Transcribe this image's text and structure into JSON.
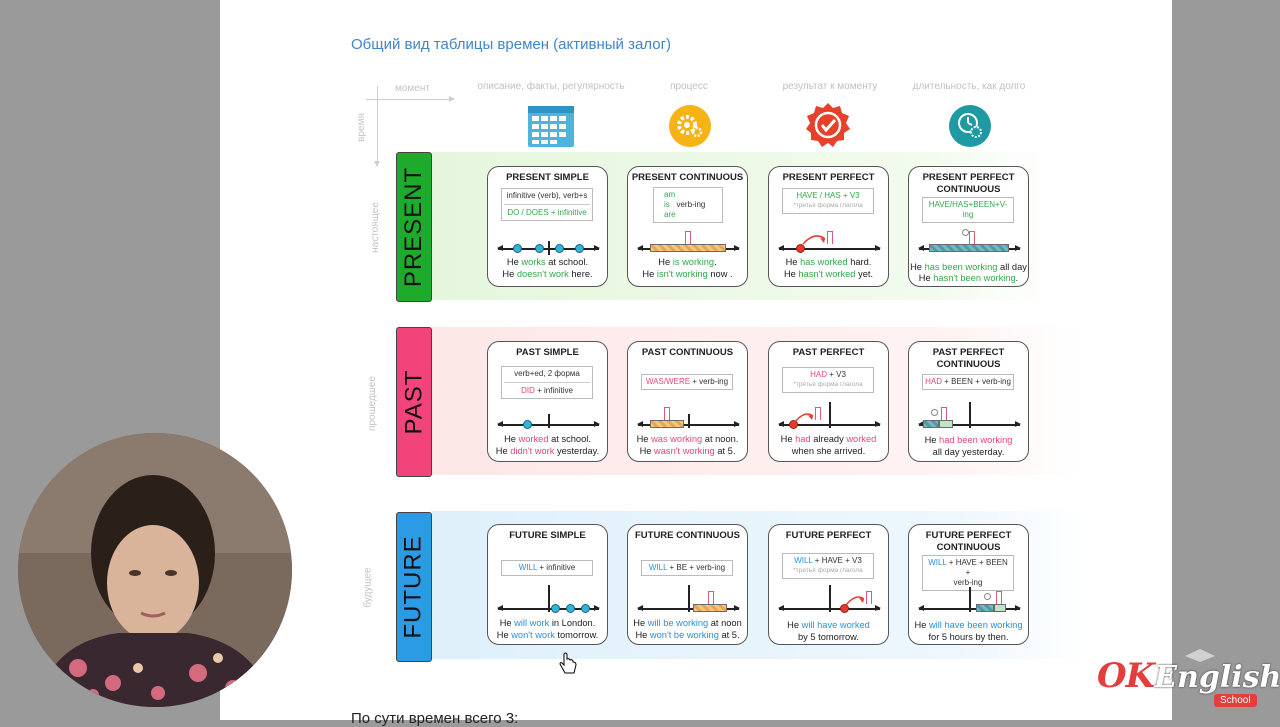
{
  "doc_title": "Общий вид таблицы времен (активный залог)",
  "next_heading": "По сути времен всего 3:",
  "axes": {
    "moment": "момент",
    "time": "время"
  },
  "column_headers": [
    "описание, факты, регулярность",
    "процесс",
    "результат к моменту",
    "длительность, как долго"
  ],
  "column_icons": [
    "calendar-icon",
    "gear-icon",
    "checkmark-badge-icon",
    "clock-gear-icon"
  ],
  "colors": {
    "present": "#1eaa2a",
    "past": "#f0447b",
    "future": "#2a9be4",
    "present_band": "#eef8e8",
    "past_band": "#fdeeee",
    "future_band": "#e8f3fb"
  },
  "rows": [
    {
      "tab": "PRESENT",
      "side": "настоящее",
      "cards": [
        {
          "title": "PRESENT SIMPLE",
          "formula": [
            "infinitive (verb), verb+s",
            "DO / DOES + infinitive"
          ],
          "ex1": [
            "He ",
            "works",
            " at school."
          ],
          "ex2": [
            "He ",
            "doesn't work",
            " here."
          ]
        },
        {
          "title": "PRESENT CONTINUOUS",
          "formula": [
            "am",
            "is   verb-ing",
            "are"
          ],
          "ex1": [
            "He ",
            "is working",
            "."
          ],
          "ex2": [
            "He ",
            "isn't working",
            " now ."
          ]
        },
        {
          "title": "PRESENT PERFECT",
          "formula": [
            "HAVE / HAS + V3",
            "*третья форма глагола"
          ],
          "ex1": [
            "He ",
            "has worked",
            " hard."
          ],
          "ex2": [
            "He ",
            "hasn't worked",
            " yet."
          ]
        },
        {
          "title": "PRESENT PERFECT CONTINUOUS",
          "formula": [
            "HAVE/HAS+BEEN+V-ing"
          ],
          "ex1": [
            "He ",
            "has been working",
            " all day"
          ],
          "ex2": [
            "He ",
            "hasn't been working",
            "."
          ]
        }
      ]
    },
    {
      "tab": "PAST",
      "side": "прошедшее",
      "cards": [
        {
          "title": "PAST SIMPLE",
          "formula": [
            "verb+ed, 2 форма",
            "DID + infinitive"
          ],
          "ex1": [
            "He ",
            "worked",
            " at school."
          ],
          "ex2": [
            "He ",
            "didn't work",
            " yesterday."
          ]
        },
        {
          "title": "PAST CONTINUOUS",
          "formula": [
            "WAS/WERE + verb-ing"
          ],
          "ex1": [
            "He ",
            "was working",
            " at noon."
          ],
          "ex2": [
            "He ",
            "wasn't working",
            " at 5."
          ]
        },
        {
          "title": "PAST PERFECT",
          "formula": [
            "HAD + V3",
            "*третья форма глагола"
          ],
          "ex1": [
            "He ",
            "had",
            " already ",
            "worked"
          ],
          "ex2": [
            "when she arrived."
          ]
        },
        {
          "title": "PAST PERFECT CONTINUOUS",
          "formula": [
            "HAD + BEEN + verb-ing"
          ],
          "ex1": [
            "He ",
            "had been working"
          ],
          "ex2": [
            "all day yesterday."
          ]
        }
      ]
    },
    {
      "tab": "FUTURE",
      "side": "будущее",
      "cards": [
        {
          "title": "FUTURE SIMPLE",
          "formula": [
            "WILL + infinitive"
          ],
          "ex1": [
            "He ",
            "will work",
            " in London."
          ],
          "ex2": [
            "He ",
            "won't work",
            " tomorrow."
          ]
        },
        {
          "title": "FUTURE CONTINUOUS",
          "formula": [
            "WILL + BE + verb-ing"
          ],
          "ex1": [
            "He ",
            "will be working",
            " at noon"
          ],
          "ex2": [
            "He ",
            "won't be working",
            " at 5."
          ]
        },
        {
          "title": "FUTURE PERFECT",
          "formula": [
            "WILL + HAVE + V3",
            "*третья форма глагола"
          ],
          "ex1": [
            "He ",
            "will have worked"
          ],
          "ex2": [
            "by 5 tomorrow."
          ]
        },
        {
          "title": "FUTURE PERFECT CONTINUOUS",
          "formula": [
            "WILL + HAVE + BEEN +",
            "verb-ing"
          ],
          "ex1": [
            "He ",
            "will have been working"
          ],
          "ex2": [
            "for 5 hours by then."
          ]
        }
      ]
    }
  ],
  "logo": {
    "ok": "OK",
    "english": "English",
    "school": "School"
  },
  "cursor_icon": "hand-cursor-icon",
  "webcam": "presenter-webcam"
}
